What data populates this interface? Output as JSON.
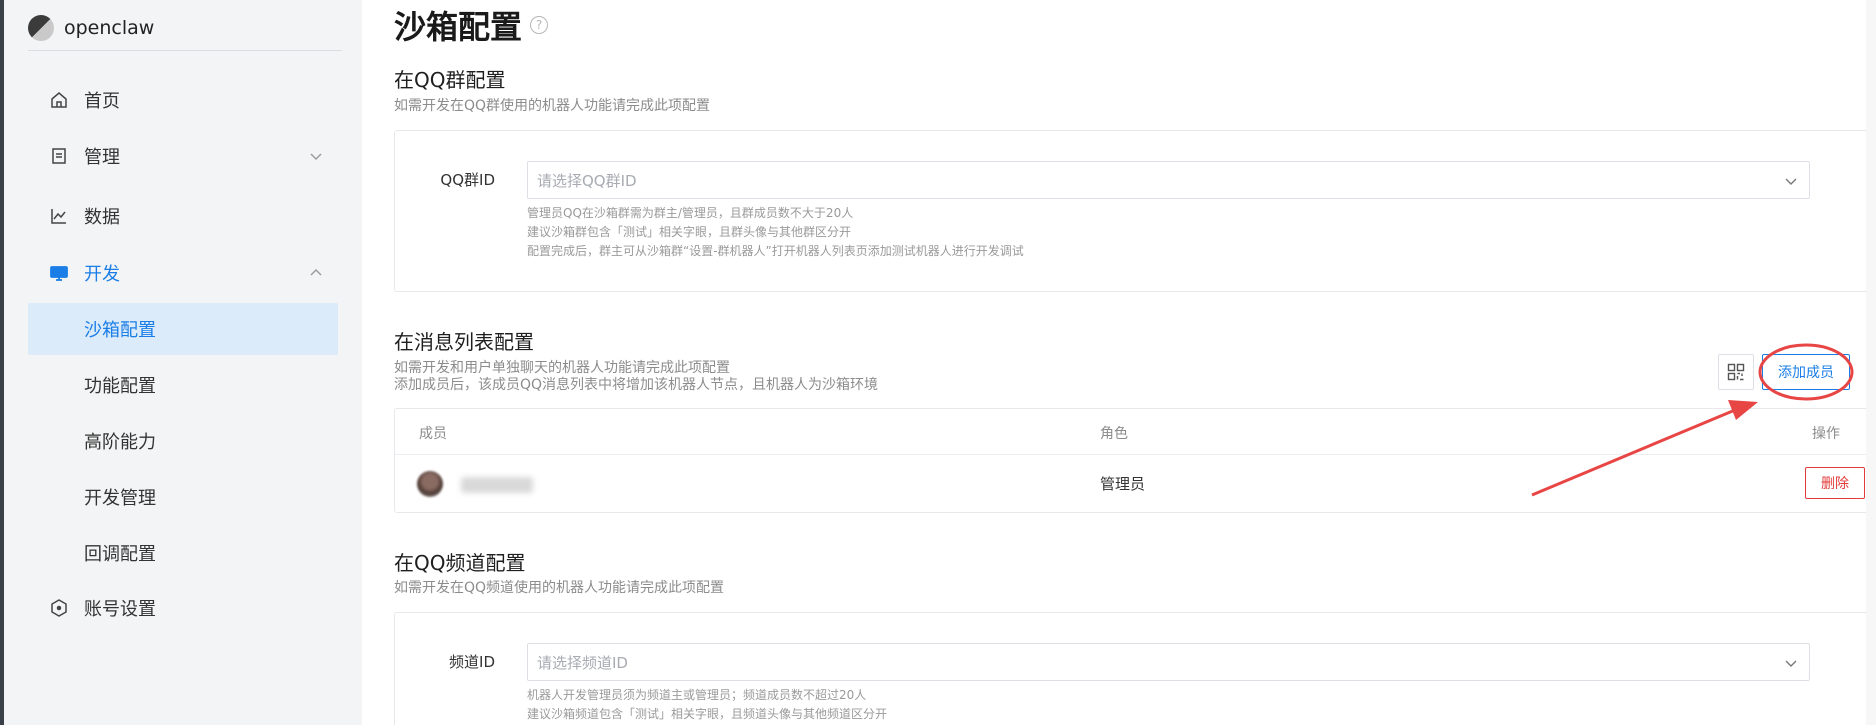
{
  "brand": {
    "name": "openclaw"
  },
  "sidebar": {
    "items": [
      {
        "label": "首页",
        "icon": "home-icon"
      },
      {
        "label": "管理",
        "icon": "document-icon"
      },
      {
        "label": "数据",
        "icon": "chart-line-icon"
      },
      {
        "label": "开发",
        "icon": "monitor-icon"
      },
      {
        "label": "账号设置",
        "icon": "settings-hex-icon"
      }
    ],
    "sub_items": [
      {
        "label": "沙箱配置"
      },
      {
        "label": "功能配置"
      },
      {
        "label": "高阶能力"
      },
      {
        "label": "开发管理"
      },
      {
        "label": "回调配置"
      }
    ]
  },
  "page": {
    "title": "沙箱配置",
    "help": "?"
  },
  "group_section": {
    "title": "在QQ群配置",
    "desc": "如需开发在QQ群使用的机器人功能请完成此项配置",
    "label": "QQ群ID",
    "placeholder": "请选择QQ群ID",
    "hints": [
      "管理员QQ在沙箱群需为群主/管理员，且群成员数不大于20人",
      "建议沙箱群包含「测试」相关字眼，且群头像与其他群区分开",
      "配置完成后，群主可从沙箱群“设置-群机器人”打开机器人列表页添加测试机器人进行开发调试"
    ]
  },
  "message_section": {
    "title": "在消息列表配置",
    "desc1": "如需开发和用户单独聊天的机器人功能请完成此项配置",
    "desc2": "添加成员后，该成员QQ消息列表中将增加该机器人节点，且机器人为沙箱环境",
    "add_button": "添加成员",
    "columns": {
      "member": "成员",
      "role": "角色",
      "action": "操作"
    },
    "rows": [
      {
        "role": "管理员",
        "delete": "删除"
      }
    ]
  },
  "channel_section": {
    "title": "在QQ频道配置",
    "desc": "如需开发在QQ频道使用的机器人功能请完成此项配置",
    "label": "频道ID",
    "placeholder": "请选择频道ID",
    "hints": [
      "机器人开发管理员须为频道主或管理员；频道成员数不超过20人",
      "建议沙箱频道包含「测试」相关字眼，且频道头像与其他频道区分开"
    ]
  },
  "colors": {
    "accent": "#1a7ee6",
    "danger": "#e23b3b",
    "annotation": "#e84545"
  }
}
